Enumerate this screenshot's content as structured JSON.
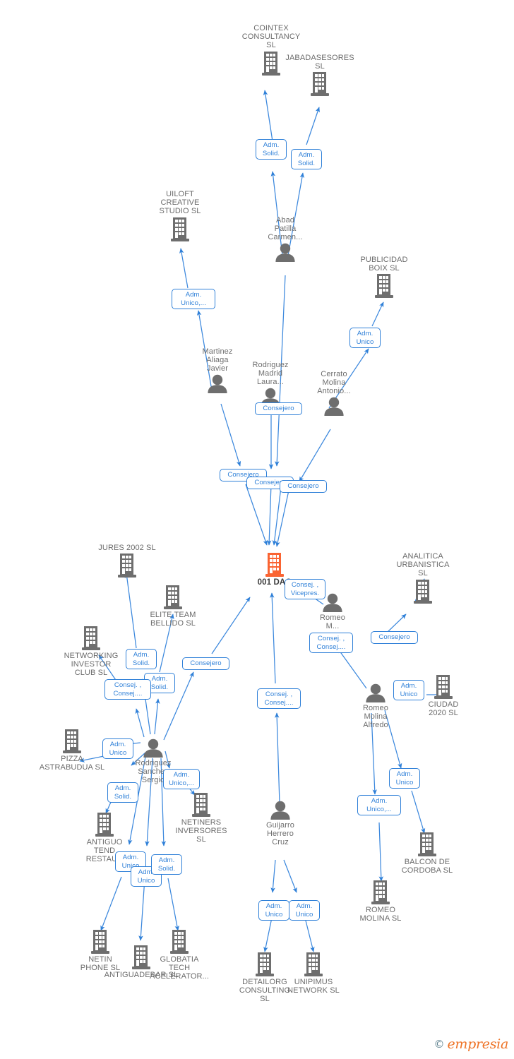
{
  "meta": {
    "watermark_symbol": "©",
    "watermark_brand": "empresia",
    "accent_blue": "#2f80d8",
    "root_orange": "#fa6432",
    "icon_gray": "#6e6e6e",
    "label_gray": "#6b6b6b"
  },
  "graph": {
    "type": "corporate-relationship-network",
    "root": {
      "id": "root",
      "label": "001 DAO",
      "kind": "company",
      "highlighted": true,
      "color": "#fa6432"
    },
    "companies": [
      {
        "id": "cointex",
        "label": "COINTEX\nCONSULTANCY\nSL"
      },
      {
        "id": "jabadasesores",
        "label": "JABADASESORES\nSL"
      },
      {
        "id": "uiloft",
        "label": "UILOFT\nCREATIVE\nSTUDIO  SL"
      },
      {
        "id": "publicidad",
        "label": "PUBLICIDAD\nBOIX  SL"
      },
      {
        "id": "jures",
        "label": "JURES 2002 SL"
      },
      {
        "id": "eliteteam",
        "label": "ELITE TEAM\nBELLIDO  SL"
      },
      {
        "id": "networking",
        "label": "NETWORKING\nINVESTOR\nCLUB  SL"
      },
      {
        "id": "pizza",
        "label": "PIZZA\nASTRABUDUA SL"
      },
      {
        "id": "antiguo",
        "label": "ANTIGUO\nTEND\nRESTAUR"
      },
      {
        "id": "netiners",
        "label": "NETINERS\nINVERSORES\nSL"
      },
      {
        "id": "netin",
        "label": "NETIN\nPHONE  SL"
      },
      {
        "id": "antiguadebar",
        "label": "ANTIGUADEBAR SL"
      },
      {
        "id": "globatia",
        "label": "GLOBATIA\nTECH\nACELERATOR..."
      },
      {
        "id": "detailorg",
        "label": "DETAILORG\nCONSULTING\nSL"
      },
      {
        "id": "unipimus",
        "label": "UNIPIMUS\nNETWORK  SL"
      },
      {
        "id": "analitica",
        "label": "ANALITICA\nURBANISTICA\nSL"
      },
      {
        "id": "ciudad",
        "label": "CIUDAD\n2020 SL"
      },
      {
        "id": "balcon",
        "label": "BALCON DE\nCORDOBA SL"
      },
      {
        "id": "romeosl",
        "label": "ROMEO\nMOLINA  SL"
      }
    ],
    "people": [
      {
        "id": "abad",
        "label": "Abad\nPatilla\nCarmen..."
      },
      {
        "id": "martinez",
        "label": "Martinez\nAliaga\nJavier"
      },
      {
        "id": "rodmadrid",
        "label": "Rodriguez\nMadrid\nLaura..."
      },
      {
        "id": "cerrato",
        "label": "Cerrato\nMolina\nAntonio..."
      },
      {
        "id": "romeo",
        "label": "Romeo\nM..."
      },
      {
        "id": "rodsanchez",
        "label": "Rodriguez\nSanchez\nSergio"
      },
      {
        "id": "guijarro",
        "label": "Guijarro\nHerrero\nCruz"
      },
      {
        "id": "romeomolina",
        "label": "Romeo\nMolina\nAlfredo"
      }
    ],
    "relations": [
      {
        "id": "r01",
        "from": "abad",
        "to": "cointex",
        "label": "Adm.\nSolid."
      },
      {
        "id": "r02",
        "from": "abad",
        "to": "jabadasesores",
        "label": "Adm.\nSolid."
      },
      {
        "id": "r03",
        "from": "martinez",
        "to": "uiloft",
        "label": "Adm.\nUnico,..."
      },
      {
        "id": "r04",
        "from": "cerrato",
        "to": "publicidad",
        "label": "Adm.\nUnico"
      },
      {
        "id": "r05",
        "from": "rodmadrid",
        "to": "root",
        "label": "Consejero"
      },
      {
        "id": "r06",
        "from": "martinez",
        "to": "root",
        "label": "Consejero"
      },
      {
        "id": "r07",
        "from": "abad",
        "to": "root",
        "label": "Consejero"
      },
      {
        "id": "r08",
        "from": "cerrato",
        "to": "root",
        "label": "Consejero"
      },
      {
        "id": "r09",
        "from": "romeo",
        "to": "root",
        "label": "Consej. ,\nVicepres."
      },
      {
        "id": "r10",
        "from": "romeo",
        "to": "analitica",
        "label": "Consejero"
      },
      {
        "id": "r11",
        "from": "romeomolina",
        "to": "root",
        "label": "Consej. ,\nConsej...."
      },
      {
        "id": "r12",
        "from": "rodsanchez",
        "to": "root",
        "label": "Consejero"
      },
      {
        "id": "r13",
        "from": "guijarro",
        "to": "root",
        "label": "Consej. ,\nConsej...."
      },
      {
        "id": "r14",
        "from": "rodsanchez",
        "to": "jures",
        "label": "Adm.\nSolid."
      },
      {
        "id": "r15",
        "from": "rodsanchez",
        "to": "eliteteam",
        "label": "Adm.\nSolid."
      },
      {
        "id": "r16",
        "from": "rodsanchez",
        "to": "networking",
        "label": "Consej. ,\nConsej...."
      },
      {
        "id": "r17",
        "from": "rodsanchez",
        "to": "pizza",
        "label": "Adm.\nUnico"
      },
      {
        "id": "r18",
        "from": "rodsanchez",
        "to": "netiners",
        "label": "Adm.\nUnico,..."
      },
      {
        "id": "r19",
        "from": "rodsanchez",
        "to": "antiguo",
        "label": "Adm.\nSolid."
      },
      {
        "id": "r20",
        "from": "rodsanchez",
        "to": "netin",
        "label": "Adm.\nUnico"
      },
      {
        "id": "r21",
        "from": "rodsanchez",
        "to": "antiguadebar",
        "label": "Adm.\nUnico"
      },
      {
        "id": "r22",
        "from": "rodsanchez",
        "to": "globatia",
        "label": "Adm.\nSolid."
      },
      {
        "id": "r23",
        "from": "guijarro",
        "to": "detailorg",
        "label": "Adm.\nUnico"
      },
      {
        "id": "r24",
        "from": "guijarro",
        "to": "unipimus",
        "label": "Adm.\nUnico"
      },
      {
        "id": "r25",
        "from": "romeomolina",
        "to": "ciudad",
        "label": "Adm.\nUnico"
      },
      {
        "id": "r26",
        "from": "romeomolina",
        "to": "balcon",
        "label": "Adm.\nUnico"
      },
      {
        "id": "r27",
        "from": "romeomolina",
        "to": "romeosl",
        "label": "Adm.\nUnico,..."
      }
    ]
  }
}
